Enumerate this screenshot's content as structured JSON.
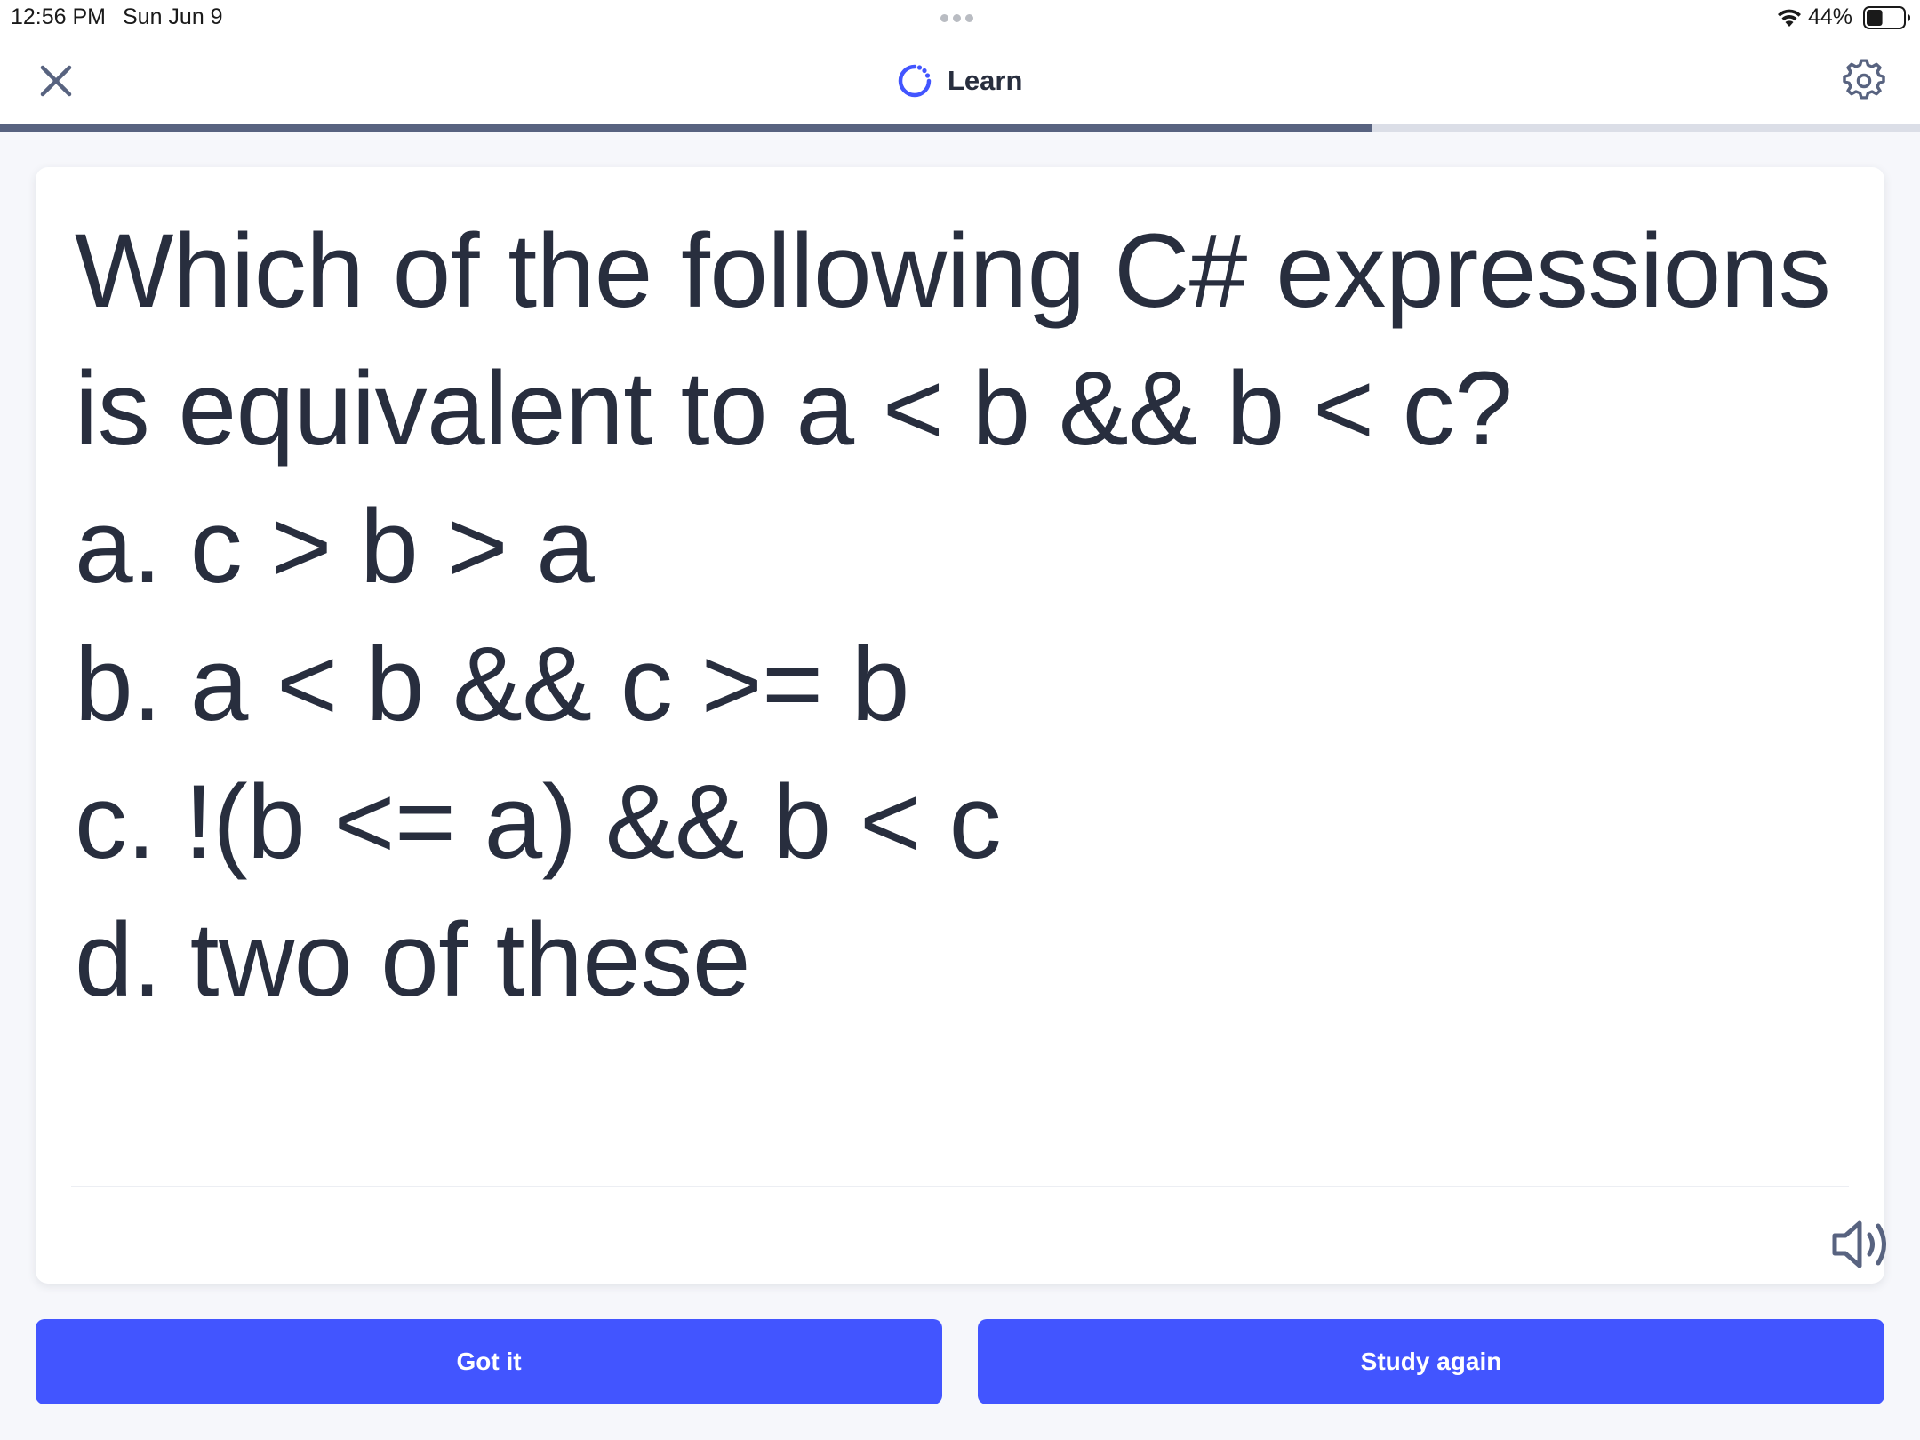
{
  "status_bar": {
    "time": "12:56 PM",
    "date": "Sun Jun 9",
    "battery_percent": "44%",
    "battery_level": 0.44,
    "icons": [
      "wifi-icon",
      "battery-icon"
    ]
  },
  "header": {
    "title": "Learn",
    "close_icon": "close-icon",
    "settings_icon": "gear-icon",
    "mode_icon": "learn-icon"
  },
  "progress": {
    "value": 0.715
  },
  "card": {
    "question": "Which of the following C# expressions is equivalent to a < b && b < c?\na. c > b > a\nb. a < b && c >= b\nc. !(b <= a) && b < c\nd. two of these",
    "audio_icon": "speaker-icon"
  },
  "actions": {
    "got_it": "Got it",
    "study_again": "Study again"
  },
  "colors": {
    "accent": "#4255ff",
    "text": "#282e3e",
    "progress_fill": "#586380",
    "progress_track": "#dbdee7",
    "background": "#f6f7fb"
  }
}
